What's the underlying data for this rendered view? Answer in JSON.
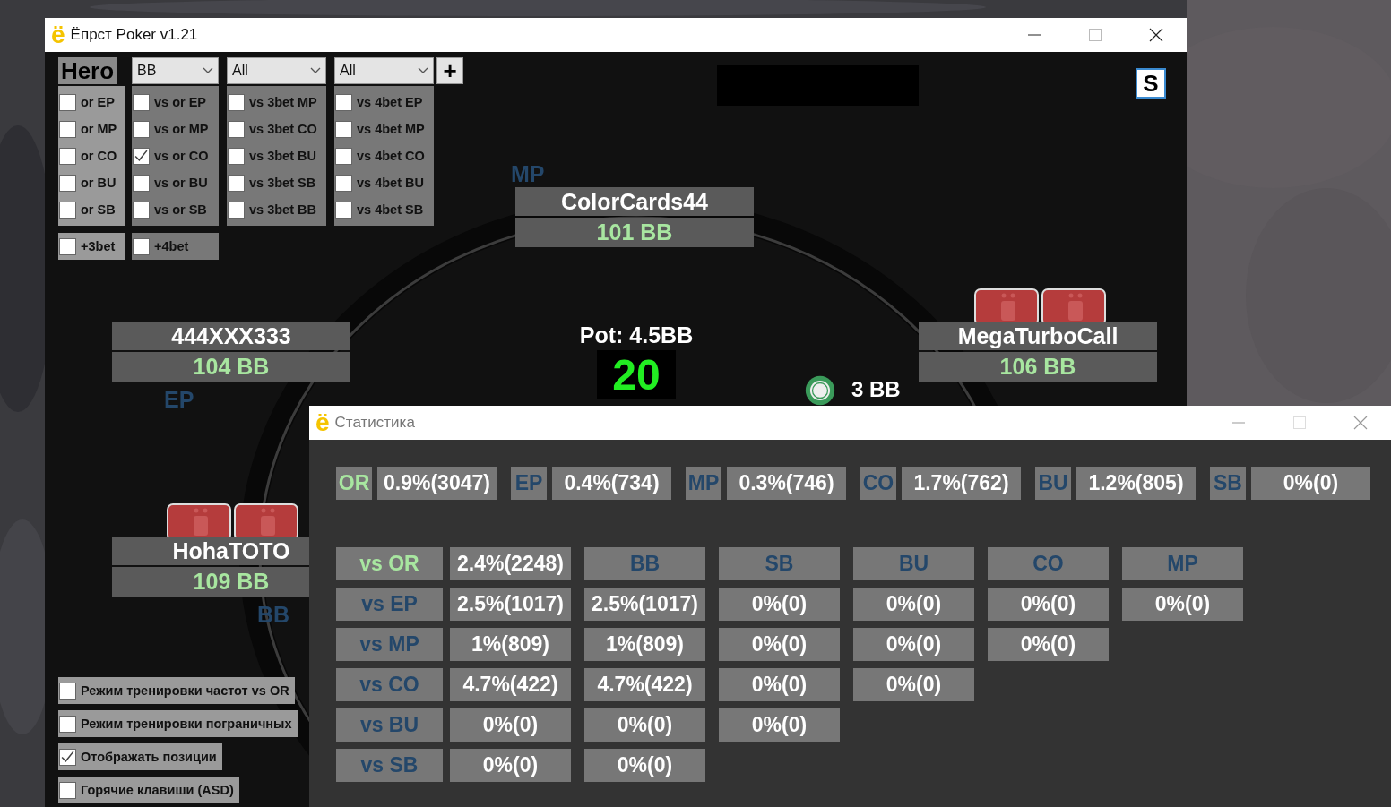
{
  "main_window": {
    "app_icon": "ё",
    "title": "Ёпрст Poker v1.21"
  },
  "hero_label": "Hero",
  "dropdowns": [
    {
      "value": "BB"
    },
    {
      "value": "All"
    },
    {
      "value": "All"
    }
  ],
  "add_button": "+",
  "filter_columns": [
    [
      {
        "label": "or EP",
        "checked": false
      },
      {
        "label": "or MP",
        "checked": false
      },
      {
        "label": "or CO",
        "checked": false
      },
      {
        "label": "or BU",
        "checked": false
      },
      {
        "label": "or SB",
        "checked": false
      }
    ],
    [
      {
        "label": "vs or EP",
        "checked": false
      },
      {
        "label": "vs or MP",
        "checked": false
      },
      {
        "label": "vs or CO",
        "checked": true
      },
      {
        "label": "vs or BU",
        "checked": false
      },
      {
        "label": "vs or SB",
        "checked": false
      }
    ],
    [
      {
        "label": "vs 3bet MP",
        "checked": false
      },
      {
        "label": "vs 3bet CO",
        "checked": false
      },
      {
        "label": "vs 3bet BU",
        "checked": false
      },
      {
        "label": "vs 3bet SB",
        "checked": false
      },
      {
        "label": "vs 3bet BB",
        "checked": false
      }
    ],
    [
      {
        "label": "vs 4bet EP",
        "checked": false
      },
      {
        "label": "vs 4bet MP",
        "checked": false
      },
      {
        "label": "vs 4bet CO",
        "checked": false
      },
      {
        "label": "vs 4bet BU",
        "checked": false
      },
      {
        "label": "vs 4bet SB",
        "checked": false
      }
    ]
  ],
  "extra_filters": [
    {
      "label": "+3bet",
      "checked": false
    },
    {
      "label": "+4bet",
      "checked": false
    }
  ],
  "options": [
    {
      "label": "Режим тренировки частот vs OR",
      "checked": false
    },
    {
      "label": "Режим тренировки пограничных",
      "checked": false
    },
    {
      "label": "Отображать позиции",
      "checked": true
    },
    {
      "label": "Горячие клавиши (ASD)",
      "checked": false
    }
  ],
  "s_button": "S",
  "seats": [
    {
      "name": "ColorCards44",
      "stack": "101 BB",
      "position": "MP",
      "has_cards": false
    },
    {
      "name": "444XXX333",
      "stack": "104 BB",
      "position": "EP",
      "has_cards": false
    },
    {
      "name": "MegaTurboCall",
      "stack": "106 BB",
      "has_cards": true
    },
    {
      "name": "HohaTOTO",
      "stack": "109 BB",
      "position": "BB",
      "has_cards": true
    }
  ],
  "pot": {
    "label": "Pot: 4.5BB",
    "timer": "20"
  },
  "bet": {
    "amount": "3 BB"
  },
  "stats_window": {
    "app_icon": "ё",
    "title": "Статистика",
    "summary": [
      {
        "label": "OR",
        "value": "0.9%(3047)",
        "kind": "total"
      },
      {
        "label": "EP",
        "value": "0.4%(734)",
        "kind": "position"
      },
      {
        "label": "MP",
        "value": "0.3%(746)",
        "kind": "position"
      },
      {
        "label": "CO",
        "value": "1.7%(762)",
        "kind": "position"
      },
      {
        "label": "BU",
        "value": "1.2%(805)",
        "kind": "position"
      },
      {
        "label": "SB",
        "value": "0%(0)",
        "kind": "position"
      }
    ],
    "grid_header": {
      "label": "vs OR",
      "value": "2.4%(2248)",
      "columns": [
        "BB",
        "SB",
        "BU",
        "CO",
        "MP"
      ]
    },
    "grid_rows": [
      {
        "label": "vs EP",
        "values": [
          "2.5%(1017)",
          "2.5%(1017)",
          "0%(0)",
          "0%(0)",
          "0%(0)",
          "0%(0)"
        ]
      },
      {
        "label": "vs MP",
        "values": [
          "1%(809)",
          "1%(809)",
          "0%(0)",
          "0%(0)",
          "0%(0)"
        ]
      },
      {
        "label": "vs CO",
        "values": [
          "4.7%(422)",
          "4.7%(422)",
          "0%(0)",
          "0%(0)"
        ]
      },
      {
        "label": "vs BU",
        "values": [
          "0%(0)",
          "0%(0)",
          "0%(0)"
        ]
      },
      {
        "label": "vs SB",
        "values": [
          "0%(0)",
          "0%(0)"
        ]
      }
    ]
  }
}
